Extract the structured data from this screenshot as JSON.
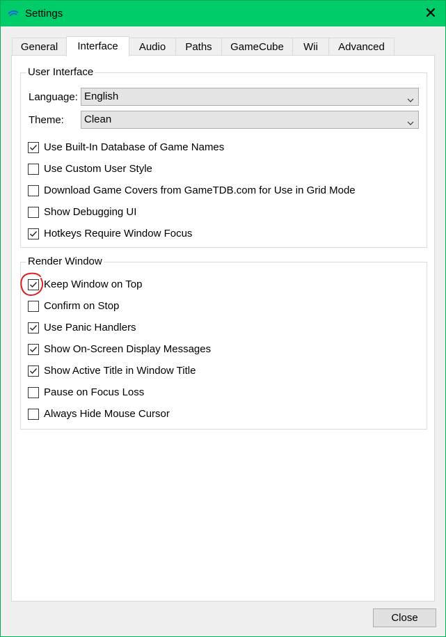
{
  "window": {
    "title": "Settings",
    "close_glyph": "✕",
    "icon": "dolphin-app-icon",
    "titlebar_color": "#00cc6a"
  },
  "tabs": [
    {
      "label": "General",
      "active": false
    },
    {
      "label": "Interface",
      "active": true
    },
    {
      "label": "Audio",
      "active": false
    },
    {
      "label": "Paths",
      "active": false
    },
    {
      "label": "GameCube",
      "active": false
    },
    {
      "label": "Wii",
      "active": false
    },
    {
      "label": "Advanced",
      "active": false
    }
  ],
  "user_interface": {
    "title": "User Interface",
    "language_label": "Language:",
    "language_value": "English",
    "theme_label": "Theme:",
    "theme_value": "Clean",
    "checkboxes": [
      {
        "label": "Use Built-In Database of Game Names",
        "checked": true
      },
      {
        "label": "Use Custom User Style",
        "checked": false
      },
      {
        "label": "Download Game Covers from GameTDB.com for Use in Grid Mode",
        "checked": false
      },
      {
        "label": "Show Debugging UI",
        "checked": false
      },
      {
        "label": "Hotkeys Require Window Focus",
        "checked": true
      }
    ]
  },
  "render_window": {
    "title": "Render Window",
    "checkboxes": [
      {
        "label": "Keep Window on Top",
        "checked": true
      },
      {
        "label": "Confirm on Stop",
        "checked": false
      },
      {
        "label": "Use Panic Handlers",
        "checked": true
      },
      {
        "label": "Show On-Screen Display Messages",
        "checked": true
      },
      {
        "label": "Show Active Title in Window Title",
        "checked": true
      },
      {
        "label": "Pause on Focus Loss",
        "checked": false
      },
      {
        "label": "Always Hide Mouse Cursor",
        "checked": false
      }
    ]
  },
  "annotation": {
    "color": "#e02020",
    "target": "Keep Window on Top"
  },
  "footer": {
    "close_label": "Close"
  }
}
